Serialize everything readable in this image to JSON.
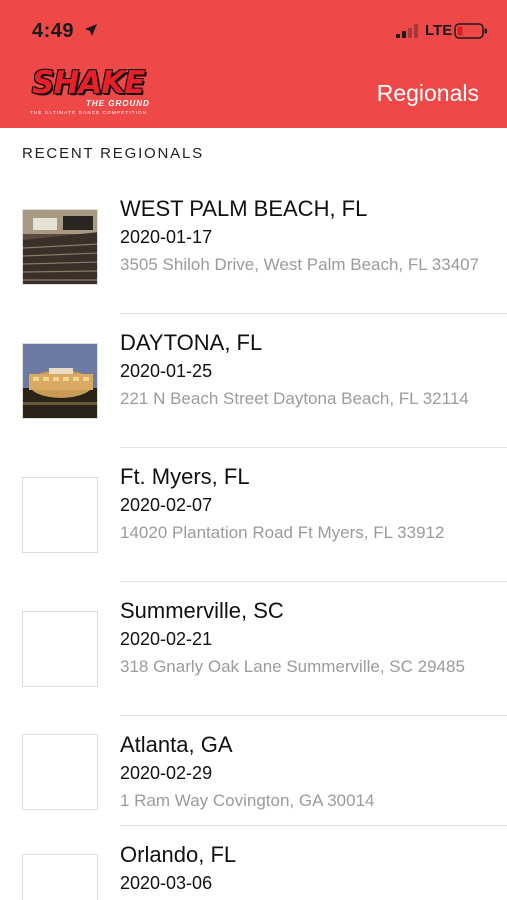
{
  "status_bar": {
    "time": "4:49",
    "network": "LTE"
  },
  "header": {
    "logo_text": "SHAKE",
    "logo_sub": "THE GROUND",
    "logo_tagline": "THE ULTIMATE DANCE COMPETITION",
    "title": "Regionals",
    "background_color": "#ee4848"
  },
  "section_label": "RECENT REGIONALS",
  "regionals": [
    {
      "title": "WEST PALM BEACH, FL",
      "date": "2020-01-17",
      "address": "3505 Shiloh Drive, West Palm Beach, FL 33407",
      "thumbnail": "auditorium-photo"
    },
    {
      "title": "DAYTONA, FL",
      "date": "2020-01-25",
      "address": "221 N Beach Street Daytona Beach, FL 32114",
      "thumbnail": "building-photo"
    },
    {
      "title": "Ft. Myers, FL",
      "date": "2020-02-07",
      "address": "14020 Plantation Road Ft Myers, FL 33912",
      "thumbnail": "blank"
    },
    {
      "title": "Summerville, SC",
      "date": "2020-02-21",
      "address": "318 Gnarly Oak Lane Summerville, SC 29485",
      "thumbnail": "blank"
    },
    {
      "title": "Atlanta, GA",
      "date": "2020-02-29",
      "address": "1 Ram Way Covington, GA 30014",
      "thumbnail": "blank"
    },
    {
      "title": "Orlando, FL",
      "date": "2020-03-06",
      "address": "",
      "thumbnail": "blank"
    }
  ]
}
